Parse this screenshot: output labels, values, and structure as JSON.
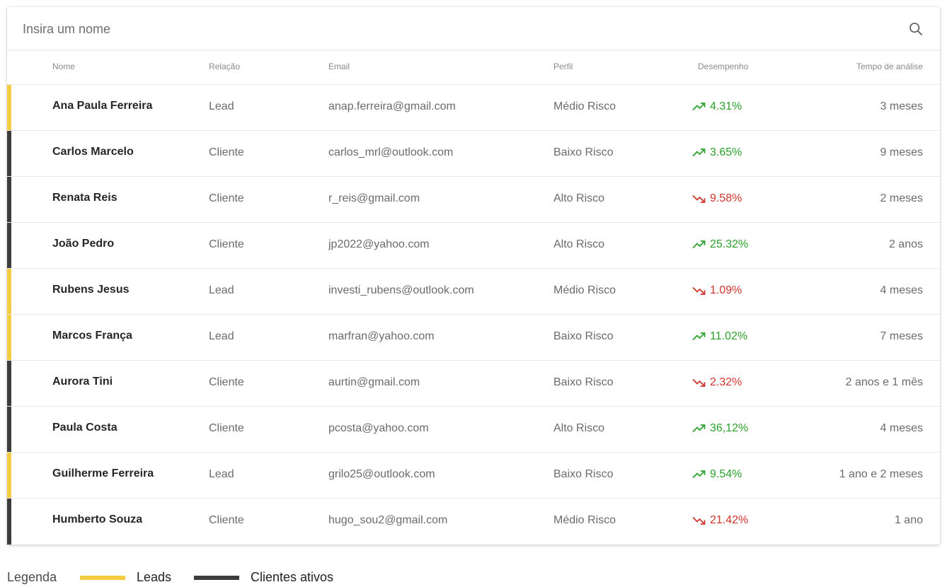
{
  "search": {
    "placeholder": "Insira um nome"
  },
  "colors": {
    "lead": "#f2cd41",
    "cliente": "#3d3d3d",
    "positive": "#2ca02c",
    "negative": "#d0342c"
  },
  "table": {
    "headers": {
      "nome": "Nome",
      "relacao": "Relação",
      "email": "Email",
      "perfil": "Perfil",
      "desempenho": "Desempenho",
      "tempo": "Tempo de análise"
    },
    "rows": [
      {
        "nome": "Ana Paula Ferreira",
        "relacao": "Lead",
        "email": "anap.ferreira@gmail.com",
        "perfil": "Médio Risco",
        "trend": "up",
        "desempenho": "4.31%",
        "tempo": "3 meses",
        "type": "lead"
      },
      {
        "nome": "Carlos Marcelo",
        "relacao": "Cliente",
        "email": "carlos_mrl@outlook.com",
        "perfil": "Baixo Risco",
        "trend": "up",
        "desempenho": "3.65%",
        "tempo": "9 meses",
        "type": "cliente"
      },
      {
        "nome": "Renata Reis",
        "relacao": "Cliente",
        "email": "r_reis@gmail.com",
        "perfil": "Alto Risco",
        "trend": "down",
        "desempenho": "9.58%",
        "tempo": "2 meses",
        "type": "cliente"
      },
      {
        "nome": "João Pedro",
        "relacao": "Cliente",
        "email": "jp2022@yahoo.com",
        "perfil": "Alto Risco",
        "trend": "up",
        "desempenho": "25.32%",
        "tempo": "2 anos",
        "type": "cliente"
      },
      {
        "nome": "Rubens Jesus",
        "relacao": "Lead",
        "email": "investi_rubens@outlook.com",
        "perfil": "Médio Risco",
        "trend": "down",
        "desempenho": "1.09%",
        "tempo": "4 meses",
        "type": "lead"
      },
      {
        "nome": "Marcos França",
        "relacao": "Lead",
        "email": "marfran@yahoo.com",
        "perfil": "Baixo Risco",
        "trend": "up",
        "desempenho": "11.02%",
        "tempo": "7 meses",
        "type": "lead"
      },
      {
        "nome": "Aurora Tini",
        "relacao": "Cliente",
        "email": "aurtin@gmail.com",
        "perfil": "Baixo Risco",
        "trend": "down",
        "desempenho": "2.32%",
        "tempo": "2 anos e 1 mês",
        "type": "cliente"
      },
      {
        "nome": "Paula Costa",
        "relacao": "Cliente",
        "email": "pcosta@yahoo.com",
        "perfil": "Alto Risco",
        "trend": "up",
        "desempenho": "36,12%",
        "tempo": "4 meses",
        "type": "cliente"
      },
      {
        "nome": "Guilherme Ferreira",
        "relacao": "Lead",
        "email": "grilo25@outlook.com",
        "perfil": "Baixo Risco",
        "trend": "up",
        "desempenho": "9.54%",
        "tempo": "1 ano e 2 meses",
        "type": "lead"
      },
      {
        "nome": "Humberto Souza",
        "relacao": "Cliente",
        "email": "hugo_sou2@gmail.com",
        "perfil": "Médio Risco",
        "trend": "down",
        "desempenho": "21.42%",
        "tempo": "1 ano",
        "type": "cliente"
      }
    ]
  },
  "legend": {
    "title": "Legenda",
    "leads": "Leads",
    "clientes": "Clientes ativos"
  }
}
